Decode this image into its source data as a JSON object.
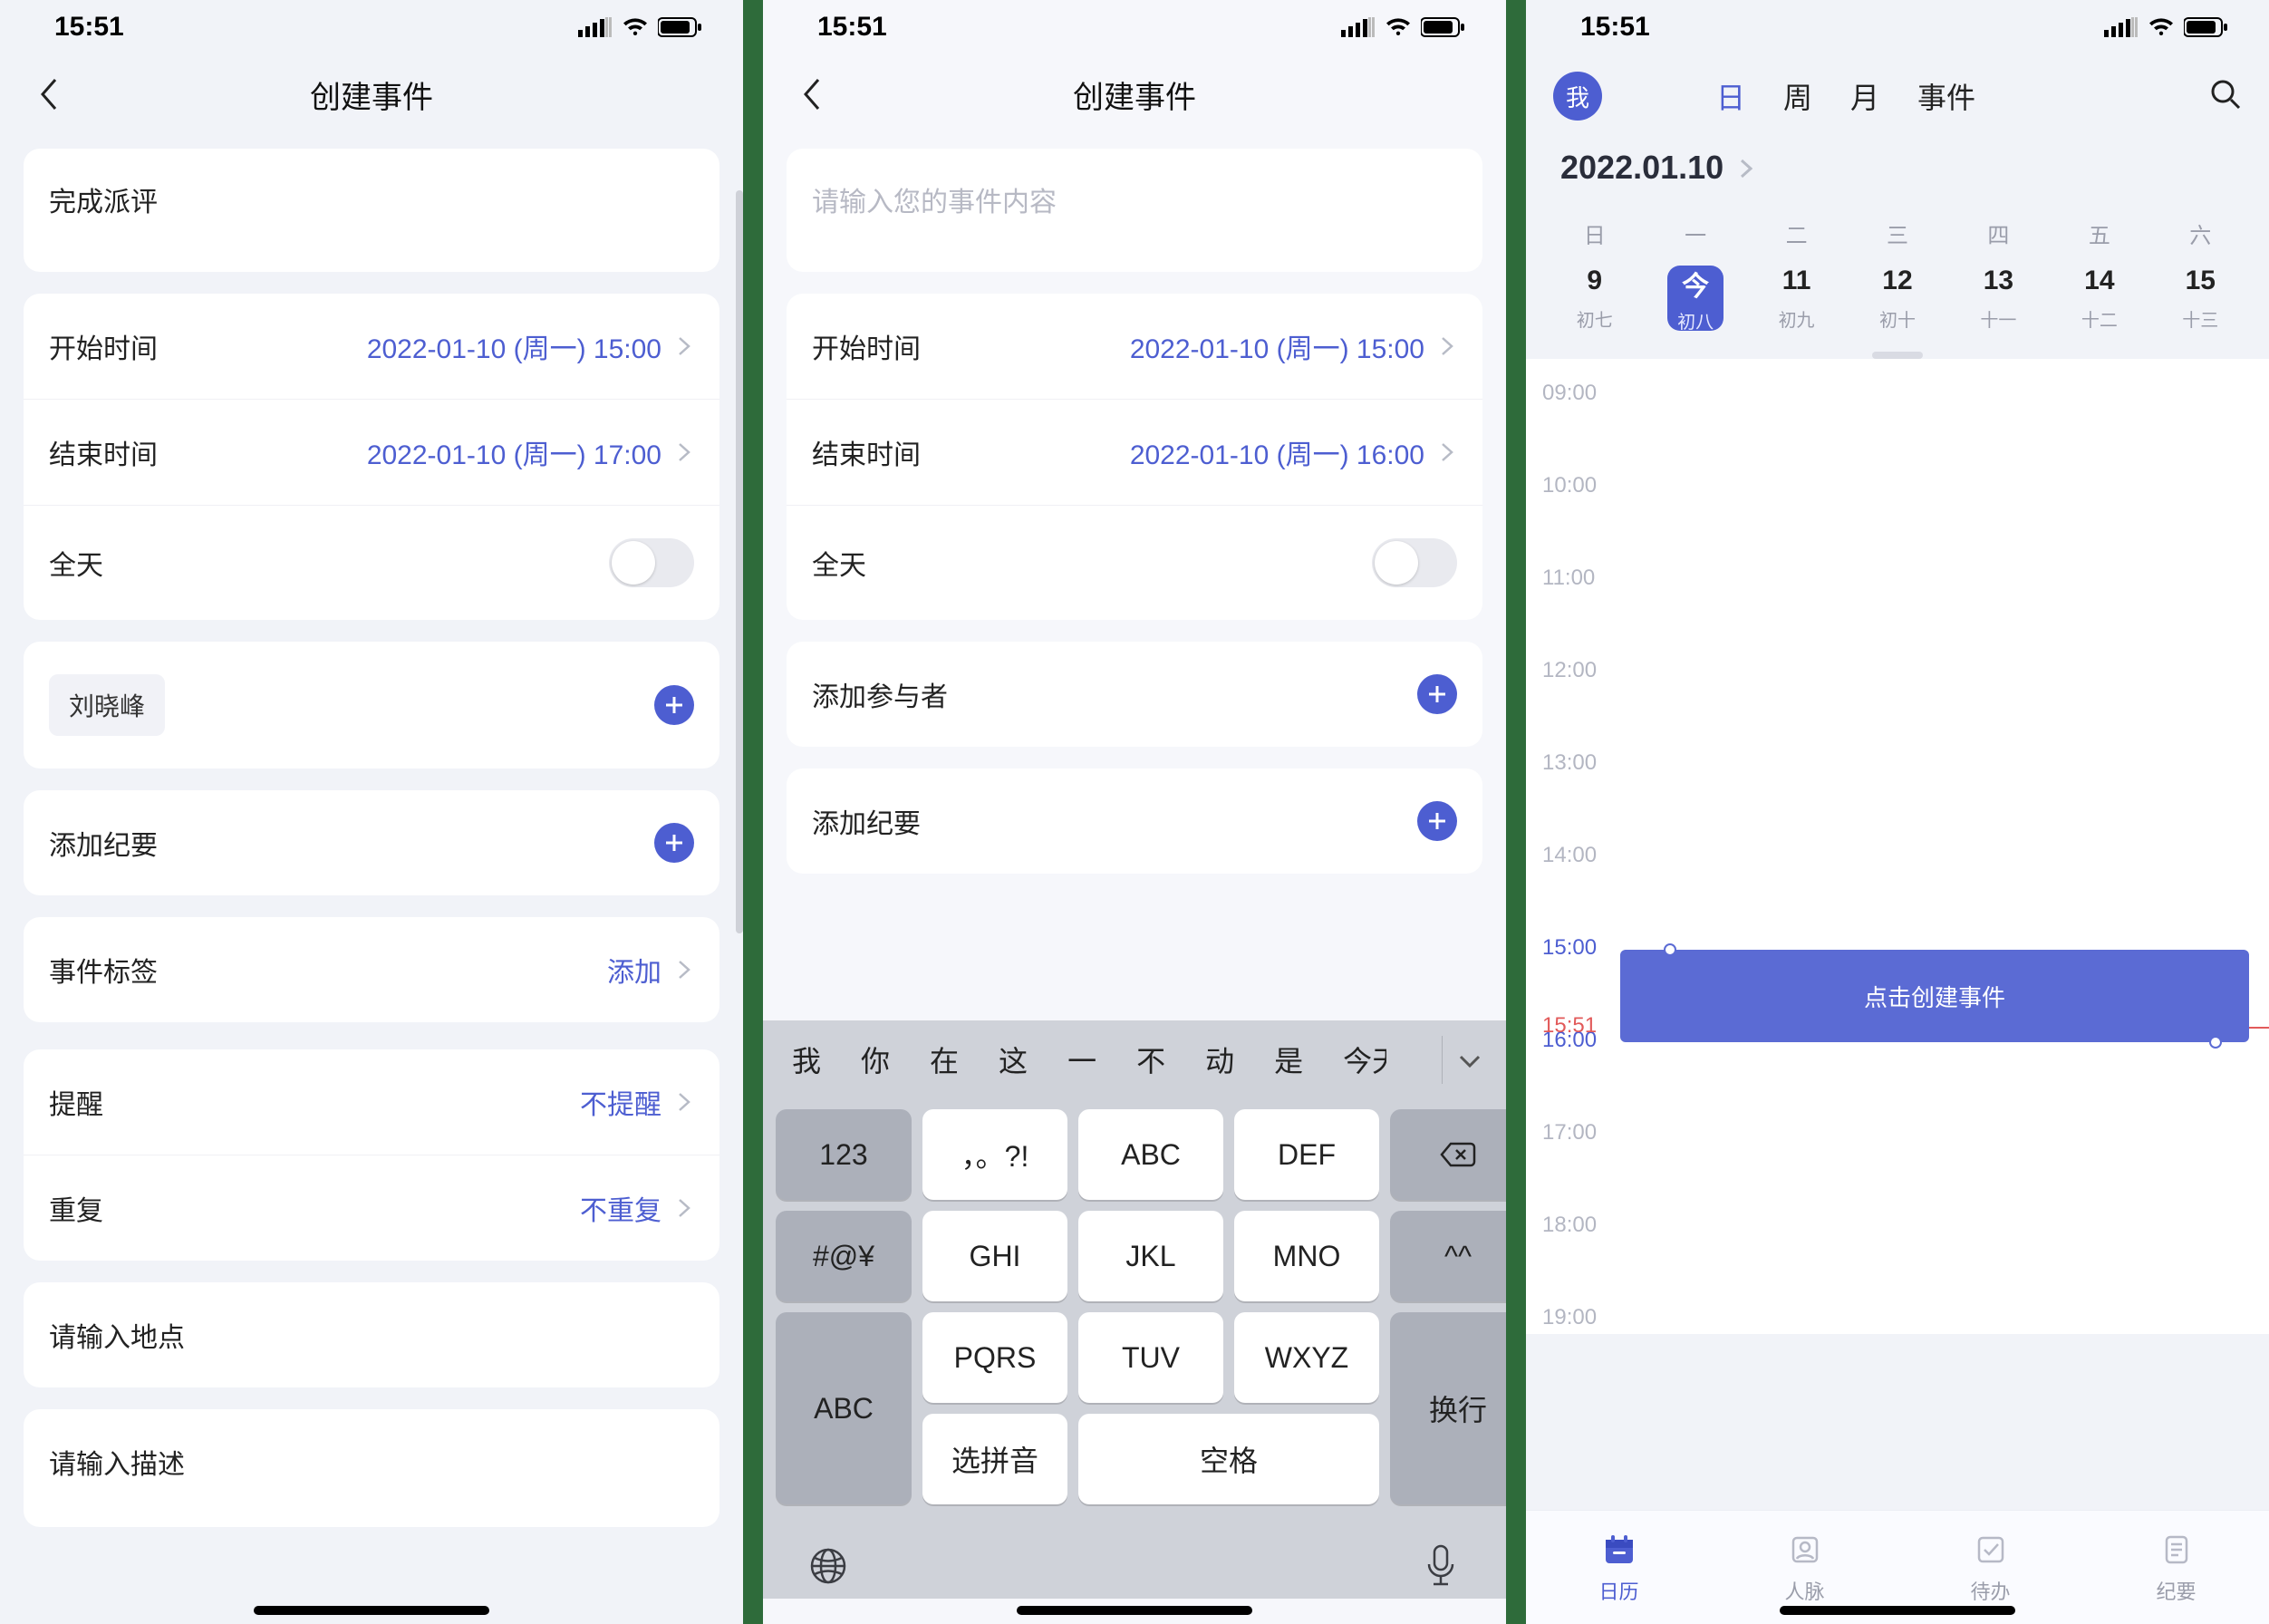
{
  "status": {
    "time": "15:51"
  },
  "screen1": {
    "nav_title": "创建事件",
    "event_text": "完成派评",
    "start_label": "开始时间",
    "start_value": "2022-01-10 (周一) 15:00",
    "end_label": "结束时间",
    "end_value": "2022-01-10 (周一) 17:00",
    "allday_label": "全天",
    "participant_chip": "刘晓峰",
    "add_notes_label": "添加纪要",
    "tag_label": "事件标签",
    "tag_value": "添加",
    "remind_label": "提醒",
    "remind_value": "不提醒",
    "repeat_label": "重复",
    "repeat_value": "不重复",
    "location_placeholder": "请输入地点",
    "desc_placeholder": "请输入描述"
  },
  "screen2": {
    "nav_title": "创建事件",
    "event_placeholder": "请输入您的事件内容",
    "start_label": "开始时间",
    "start_value": "2022-01-10 (周一) 15:00",
    "end_label": "结束时间",
    "end_value": "2022-01-10 (周一) 16:00",
    "allday_label": "全天",
    "add_participant_label": "添加参与者",
    "add_notes_label": "添加纪要",
    "keyboard": {
      "suggestions": [
        "我",
        "你",
        "在",
        "这",
        "一",
        "不",
        "动",
        "是",
        "今天"
      ],
      "rows": [
        [
          "123",
          "，。?!",
          "ABC",
          "DEF",
          "⌫"
        ],
        [
          "#@¥",
          "GHI",
          "JKL",
          "MNO",
          "^^"
        ],
        [
          "ABC",
          "PQRS",
          "TUV",
          "WXYZ",
          "换行"
        ],
        [
          "",
          "选拼音",
          "空格",
          "",
          ""
        ]
      ]
    }
  },
  "screen3": {
    "avatar": "我",
    "views": [
      "日",
      "周",
      "月",
      "事件"
    ],
    "active_view_index": 0,
    "date_title": "2022.01.10",
    "week_heads": [
      "日",
      "一",
      "二",
      "三",
      "四",
      "五",
      "六"
    ],
    "days": [
      {
        "num": "9",
        "sub": "初七"
      },
      {
        "num": "今",
        "sub": "初八",
        "selected": true
      },
      {
        "num": "11",
        "sub": "初九"
      },
      {
        "num": "12",
        "sub": "初十"
      },
      {
        "num": "13",
        "sub": "十一"
      },
      {
        "num": "14",
        "sub": "十二"
      },
      {
        "num": "15",
        "sub": "十三"
      }
    ],
    "hours": [
      "09:00",
      "10:00",
      "11:00",
      "12:00",
      "13:00",
      "14:00",
      "15:00",
      "16:00",
      "17:00",
      "18:00",
      "19:00"
    ],
    "now_label": "15:51",
    "event_label": "点击创建事件",
    "tabs": [
      {
        "label": "日历",
        "active": true
      },
      {
        "label": "人脉"
      },
      {
        "label": "待办"
      },
      {
        "label": "纪要"
      }
    ]
  }
}
